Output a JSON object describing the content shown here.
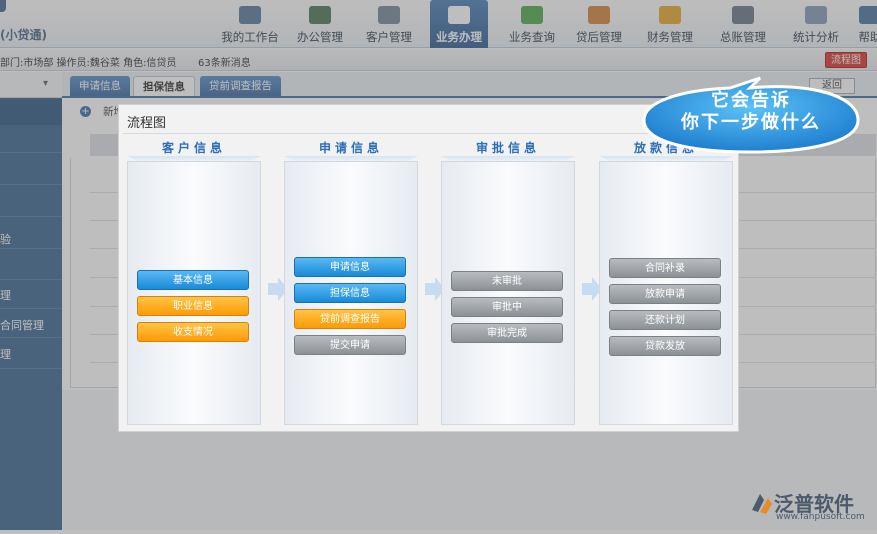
{
  "app": {
    "title": "(小贷通)"
  },
  "nav": {
    "items": [
      {
        "label": "我的工作台",
        "icon": "monitor-icon"
      },
      {
        "label": "办公管理",
        "icon": "building-icon"
      },
      {
        "label": "客户管理",
        "icon": "users-icon"
      },
      {
        "label": "业务办理",
        "icon": "handshake-icon",
        "active": true
      },
      {
        "label": "业务查询",
        "icon": "refresh-icon"
      },
      {
        "label": "贷后管理",
        "icon": "box-icon"
      },
      {
        "label": "财务管理",
        "icon": "figure-icon"
      },
      {
        "label": "总账管理",
        "icon": "ledger-icon"
      },
      {
        "label": "统计分析",
        "icon": "bar-chart-icon"
      },
      {
        "label": "帮助",
        "icon": "help-icon"
      }
    ]
  },
  "infobar": {
    "dept": "部门:市场部  操作员:魏谷菜  角色:信贷员",
    "messages": "63条新消息",
    "flow_button": "流程图"
  },
  "sidebar": {
    "labels": [
      "验",
      "理",
      "合同管理",
      "理"
    ]
  },
  "tabs": [
    {
      "label": "申请信息"
    },
    {
      "label": "担保信息",
      "active": true
    },
    {
      "label": "贷前调查报告"
    }
  ],
  "main": {
    "add_label": "新增",
    "back_button": "返回"
  },
  "modal": {
    "title": "流程图",
    "columns": [
      {
        "title": "客户信息",
        "buttons": [
          {
            "label": "基本信息",
            "style": "blue"
          },
          {
            "label": "职业信息",
            "style": "orange"
          },
          {
            "label": "收支情况",
            "style": "orange"
          }
        ]
      },
      {
        "title": "申请信息",
        "buttons": [
          {
            "label": "申请信息",
            "style": "blue"
          },
          {
            "label": "担保信息",
            "style": "blue"
          },
          {
            "label": "贷前调查报告",
            "style": "orange"
          },
          {
            "label": "提交申请",
            "style": "gray"
          }
        ]
      },
      {
        "title": "审批信息",
        "buttons": [
          {
            "label": "未审批",
            "style": "gray"
          },
          {
            "label": "审批中",
            "style": "gray"
          },
          {
            "label": "审批完成",
            "style": "gray"
          }
        ]
      },
      {
        "title": "放款信息",
        "buttons": [
          {
            "label": "合同补录",
            "style": "gray"
          },
          {
            "label": "放款申请",
            "style": "gray"
          },
          {
            "label": "还款计划",
            "style": "gray"
          },
          {
            "label": "贷款发放",
            "style": "gray"
          }
        ]
      }
    ]
  },
  "callout": {
    "line1": "它会告诉",
    "line2": "你下一步做什么"
  },
  "logo": {
    "name": "泛普软件",
    "url": "www.fanpusoft.com"
  },
  "colors": {
    "primary": "#2f64a0",
    "button_blue": "#1a8ad6",
    "button_orange": "#ff9a05",
    "button_gray": "#8c9196",
    "callout": "#2a9be0",
    "flow_button": "#d9251c"
  }
}
